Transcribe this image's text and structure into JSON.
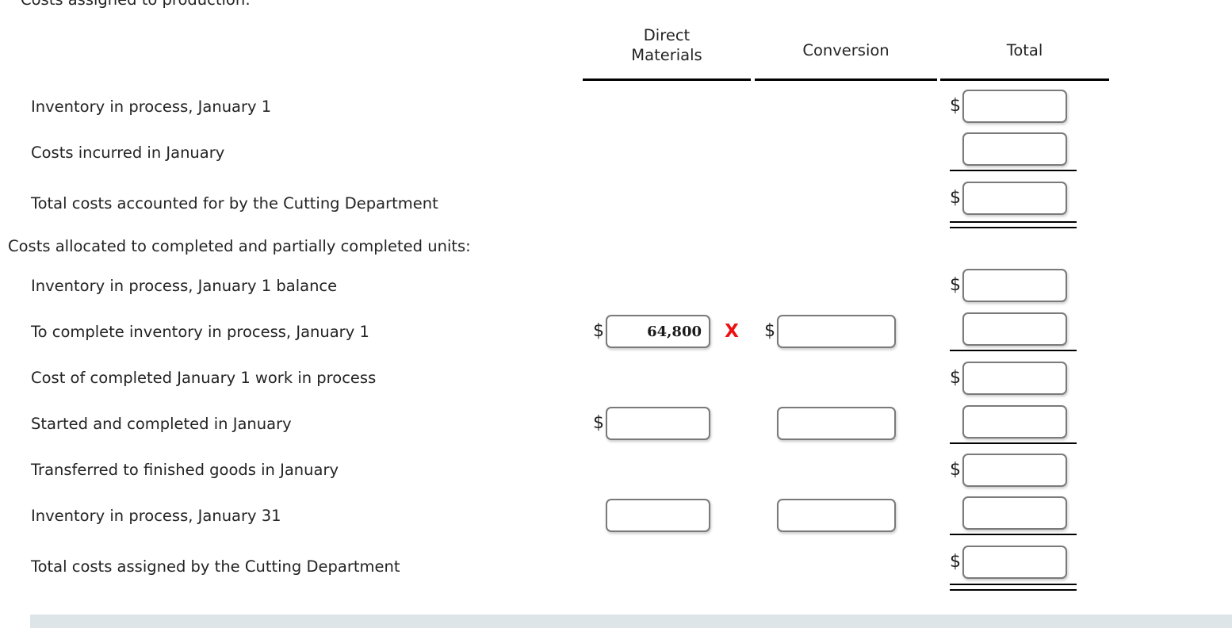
{
  "page": {
    "section_heading_top": "Costs assigned to production:",
    "section_heading_mid": "Costs allocated to completed and partially completed units:",
    "dollar_sign": "$",
    "wrong_mark": "X",
    "accent_wrong_color": "#ee1111",
    "band_color": "#dde5e8"
  },
  "columns": {
    "direct_materials_line1": "Direct",
    "direct_materials_line2": "Materials",
    "conversion": "Conversion",
    "total": "Total"
  },
  "rows": [
    {
      "label": "Inventory in process, January 1",
      "dm": {
        "value": "",
        "dollar": false,
        "box": false
      },
      "cv": {
        "value": "",
        "dollar": false,
        "box": false
      },
      "tt": {
        "value": "",
        "dollar": true,
        "box": true
      }
    },
    {
      "label": "Costs incurred in January",
      "dm": {
        "value": "",
        "dollar": false,
        "box": false
      },
      "cv": {
        "value": "",
        "dollar": false,
        "box": false
      },
      "tt": {
        "value": "",
        "dollar": false,
        "box": true
      }
    },
    {
      "label": "Total costs accounted for by the Cutting Department",
      "dm": {
        "value": "",
        "dollar": false,
        "box": false
      },
      "cv": {
        "value": "",
        "dollar": false,
        "box": false
      },
      "tt": {
        "value": "",
        "dollar": true,
        "box": true
      }
    },
    {
      "label": "Inventory in process, January 1 balance",
      "dm": {
        "value": "",
        "dollar": false,
        "box": false
      },
      "cv": {
        "value": "",
        "dollar": false,
        "box": false
      },
      "tt": {
        "value": "",
        "dollar": true,
        "box": true
      }
    },
    {
      "label": "To complete inventory in process, January 1",
      "dm": {
        "value": "64,800",
        "dollar": true,
        "box": true,
        "wrong": true
      },
      "cv": {
        "value": "",
        "dollar": true,
        "box": true
      },
      "tt": {
        "value": "",
        "dollar": false,
        "box": true
      }
    },
    {
      "label": "Cost of completed January 1 work in process",
      "dm": {
        "value": "",
        "dollar": false,
        "box": false
      },
      "cv": {
        "value": "",
        "dollar": false,
        "box": false
      },
      "tt": {
        "value": "",
        "dollar": true,
        "box": true
      }
    },
    {
      "label": "Started and completed in January",
      "dm": {
        "value": "",
        "dollar": true,
        "box": true
      },
      "cv": {
        "value": "",
        "dollar": false,
        "box": true
      },
      "tt": {
        "value": "",
        "dollar": false,
        "box": true
      }
    },
    {
      "label": "Transferred to finished goods in January",
      "dm": {
        "value": "",
        "dollar": false,
        "box": false
      },
      "cv": {
        "value": "",
        "dollar": false,
        "box": false
      },
      "tt": {
        "value": "",
        "dollar": true,
        "box": true
      }
    },
    {
      "label": "Inventory in process, January 31",
      "dm": {
        "value": "",
        "dollar": false,
        "box": true
      },
      "cv": {
        "value": "",
        "dollar": false,
        "box": true
      },
      "tt": {
        "value": "",
        "dollar": false,
        "box": true
      }
    },
    {
      "label": "Total costs assigned by the Cutting Department",
      "dm": {
        "value": "",
        "dollar": false,
        "box": false
      },
      "cv": {
        "value": "",
        "dollar": false,
        "box": false
      },
      "tt": {
        "value": "",
        "dollar": true,
        "box": true
      }
    }
  ]
}
